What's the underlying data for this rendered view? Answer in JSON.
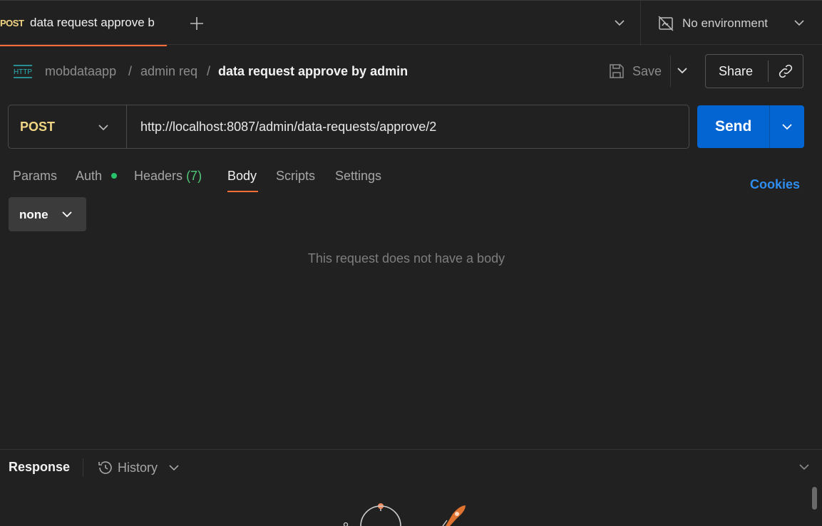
{
  "tabbar": {
    "active_tab": {
      "method": "POST",
      "title": "data request approve b"
    },
    "new_tab_icon": "plus-icon",
    "tabs_menu_icon": "chevron-down-icon",
    "environment": {
      "icon": "no-environment-icon",
      "label": "No environment"
    }
  },
  "breadcrumb": {
    "type_icon": "http-icon",
    "type_icon_text": "HTTP",
    "collection": "mobdataapp",
    "separator": "/",
    "folder": "admin req",
    "request": "data request approve by admin"
  },
  "actions": {
    "save_label": "Save",
    "share_label": "Share"
  },
  "request": {
    "method": "POST",
    "url": "http://localhost:8087/admin/data-requests/approve/2",
    "send_label": "Send"
  },
  "request_tabs": {
    "params": "Params",
    "auth": "Auth",
    "headers": "Headers",
    "headers_count": "(7)",
    "body": "Body",
    "scripts": "Scripts",
    "settings": "Settings",
    "active": "Body",
    "cookies": "Cookies"
  },
  "body": {
    "type": "none",
    "empty_message": "This request does not have a body"
  },
  "response": {
    "title": "Response",
    "history_label": "History"
  },
  "colors": {
    "accent": "#ff6c37",
    "method_post": "#f1d684",
    "send_button": "#0265d2",
    "link": "#2f8df0",
    "status_dot": "#27c26b"
  }
}
